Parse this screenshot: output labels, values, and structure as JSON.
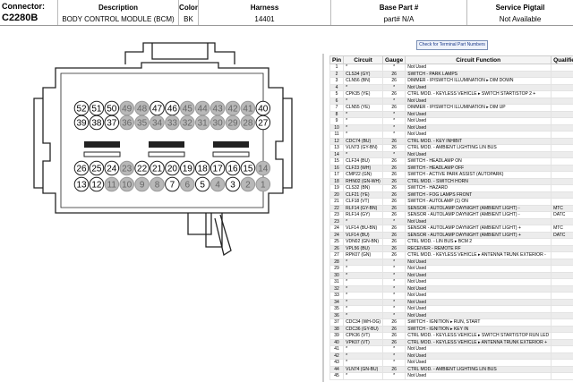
{
  "header": {
    "connector_label": "Connector:",
    "connector_value": "C2280B",
    "description_label": "Description",
    "description_value": "BODY CONTROL MODULE (BCM)",
    "color_label": "Color",
    "color_value": "BK",
    "harness_label": "Harness",
    "harness_value": "14401",
    "basepart_label": "Base Part #",
    "basepart_value": "part# N/A",
    "pigtail_label": "Service Pigtail",
    "pigtail_value": "Not Available"
  },
  "button_label": "Check for Terminal Part Numbers",
  "connector": {
    "row1": [
      "52",
      "51",
      "50",
      "49",
      "48",
      "47",
      "46",
      "45",
      "44",
      "43",
      "42",
      "41",
      "40"
    ],
    "row2": [
      "39",
      "38",
      "37",
      "36",
      "35",
      "34",
      "33",
      "32",
      "31",
      "30",
      "29",
      "28",
      "27"
    ],
    "row3": [
      "26",
      "25",
      "24",
      "23",
      "22",
      "21",
      "20",
      "19",
      "18",
      "17",
      "16",
      "15",
      "14"
    ],
    "row4": [
      "13",
      "12",
      "11",
      "10",
      "9",
      "8",
      "7",
      "6",
      "5",
      "4",
      "3",
      "2",
      "1"
    ],
    "row1_used": [
      true,
      true,
      true,
      false,
      false,
      true,
      true,
      false,
      false,
      false,
      false,
      false,
      true
    ],
    "row2_used": [
      true,
      true,
      true,
      false,
      false,
      false,
      false,
      false,
      false,
      false,
      false,
      false,
      true
    ],
    "row3_used": [
      true,
      true,
      true,
      false,
      true,
      true,
      true,
      true,
      true,
      true,
      true,
      true,
      false
    ],
    "row4_used": [
      true,
      true,
      false,
      false,
      false,
      false,
      true,
      false,
      true,
      false,
      true,
      false,
      false
    ],
    "used_fill": "#ffffff",
    "unused_fill": "#b8b8b8"
  },
  "table": {
    "headers": [
      "Pin",
      "Circuit",
      "Gauge",
      "Circuit Function",
      "Qualifier"
    ],
    "rows": [
      [
        "1",
        "*",
        "*",
        "Not Used",
        ""
      ],
      [
        "2",
        "CLS34 (GY)",
        "26",
        "SWITCH - PARK LAMPS",
        ""
      ],
      [
        "3",
        "CLN56 (BN)",
        "26",
        "DIMMER - IP/SWITCH ILLUMINATION ▸ DIM DOWN",
        ""
      ],
      [
        "4",
        "*",
        "*",
        "Not Used",
        ""
      ],
      [
        "5",
        "CPK35 (YE)",
        "26",
        "CTRL MOD. - KEYLESS VEHICLE ▸ SWITCH START/STOP 2 +",
        ""
      ],
      [
        "6",
        "*",
        "*",
        "Not Used",
        ""
      ],
      [
        "7",
        "CLN55 (YE)",
        "26",
        "DIMMER - IP/SWITCH ILLUMINATION ▸ DIM UP",
        ""
      ],
      [
        "8",
        "*",
        "*",
        "Not Used",
        ""
      ],
      [
        "9",
        "*",
        "*",
        "Not Used",
        ""
      ],
      [
        "10",
        "*",
        "*",
        "Not Used",
        ""
      ],
      [
        "11",
        "*",
        "*",
        "Not Used",
        ""
      ],
      [
        "12",
        "CDC74 (BU)",
        "26",
        "CTRL MOD. - KEY INHIBIT",
        ""
      ],
      [
        "13",
        "VLN73 (GY-BN)",
        "26",
        "CTRL MOD. - AMBIENT LIGHTING LIN BUS",
        ""
      ],
      [
        "14",
        "*",
        "*",
        "Not Used",
        ""
      ],
      [
        "15",
        "CLF24 (BU)",
        "26",
        "SWITCH - HEADLAMP ON",
        ""
      ],
      [
        "16",
        "CLF23 (WH)",
        "26",
        "SWITCH - HEADLAMP OFF",
        ""
      ],
      [
        "17",
        "CMP22 (GN)",
        "26",
        "SWITCH - ACTIVE PARK ASSIST (AUTOPARK)",
        ""
      ],
      [
        "18",
        "RHN02 (GN-WH)",
        "26",
        "CTRL MOD. - SWITCH HORN",
        ""
      ],
      [
        "19",
        "CLS32 (BN)",
        "26",
        "SWITCH - HAZARD",
        ""
      ],
      [
        "20",
        "CLF21 (YE)",
        "26",
        "SWITCH - FOG LAMPS FRONT",
        ""
      ],
      [
        "21",
        "CLF18 (VT)",
        "26",
        "SWITCH - AUTOLAMP (1) ON",
        ""
      ],
      [
        "22",
        "RLF14 (GY-BN)",
        "26",
        "SENSOR - AUTOLAMP DAYNIGHT (AMBIENT LIGHT) -",
        "MTC"
      ],
      [
        "23",
        "RLF14 (GY)",
        "26",
        "SENSOR - AUTOLAMP DAYNIGHT (AMBIENT LIGHT) -",
        "DATC"
      ],
      [
        "23",
        "*",
        "*",
        "Not Used",
        ""
      ],
      [
        "24",
        "VLF14 (BU-BN)",
        "26",
        "SENSOR - AUTOLAMP DAYNIGHT (AMBIENT LIGHT) +",
        "MTC"
      ],
      [
        "24",
        "VLF14 (BU)",
        "26",
        "SENSOR - AUTOLAMP DAYNIGHT (AMBIENT LIGHT) +",
        "DATC"
      ],
      [
        "25",
        "VDN02 (GN-BN)",
        "26",
        "CTRL MOD. - LIN BUS ▸ BCM 2",
        ""
      ],
      [
        "26",
        "VPL56 (BU)",
        "26",
        "RECEIVER - REMOTE RF",
        ""
      ],
      [
        "27",
        "RPK07 (GN)",
        "26",
        "CTRL MOD. - KEYLESS VEHICLE ▸ ANTENNA TRUNK EXTERIOR -",
        ""
      ],
      [
        "28",
        "*",
        "*",
        "Not Used",
        ""
      ],
      [
        "29",
        "*",
        "*",
        "Not Used",
        ""
      ],
      [
        "30",
        "*",
        "*",
        "Not Used",
        ""
      ],
      [
        "31",
        "*",
        "*",
        "Not Used",
        ""
      ],
      [
        "32",
        "*",
        "*",
        "Not Used",
        ""
      ],
      [
        "33",
        "*",
        "*",
        "Not Used",
        ""
      ],
      [
        "34",
        "*",
        "*",
        "Not Used",
        ""
      ],
      [
        "35",
        "*",
        "*",
        "Not Used",
        ""
      ],
      [
        "36",
        "*",
        "*",
        "Not Used",
        ""
      ],
      [
        "37",
        "CDC34 (WH-OG)",
        "26",
        "SWITCH - IGNITION ▸ RUN, START",
        ""
      ],
      [
        "38",
        "CDC36 (GY-BU)",
        "26",
        "SWITCH - IGNITION ▸ KEY IN",
        ""
      ],
      [
        "39",
        "CPK36 (VT)",
        "26",
        "CTRL MOD. - KEYLESS VEHICLE ▸ SWITCH START/STOP RUN LED",
        ""
      ],
      [
        "40",
        "VPK07 (VT)",
        "26",
        "CTRL MOD. - KEYLESS VEHICLE ▸ ANTENNA TRUNK EXTERIOR +",
        ""
      ],
      [
        "41",
        "*",
        "*",
        "Not Used",
        ""
      ],
      [
        "42",
        "*",
        "*",
        "Not Used",
        ""
      ],
      [
        "43",
        "*",
        "*",
        "Not Used",
        ""
      ],
      [
        "44",
        "VLN74 (GN-BU)",
        "26",
        "CTRL MOD. - AMBIENT LIGHTING LIN BUS",
        ""
      ],
      [
        "45",
        "*",
        "*",
        "Not Used",
        ""
      ]
    ]
  }
}
